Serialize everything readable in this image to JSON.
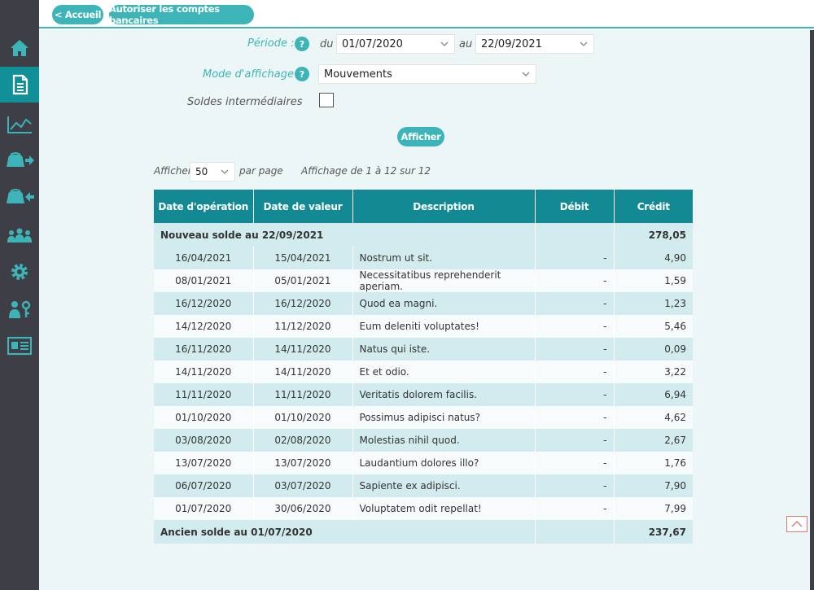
{
  "topbar": {
    "back_label": "< Accueil",
    "authorize_label": "Autoriser les comptes bancaires"
  },
  "sidebar": {
    "items": [
      {
        "icon": "home-icon"
      },
      {
        "icon": "document-icon",
        "active": true
      },
      {
        "icon": "chart-icon"
      },
      {
        "icon": "wallet-out-icon"
      },
      {
        "icon": "wallet-in-icon"
      },
      {
        "icon": "users-icon"
      },
      {
        "icon": "gear-icon"
      },
      {
        "icon": "user-key-icon"
      },
      {
        "icon": "id-card-icon"
      }
    ]
  },
  "filters": {
    "periode_label": "Période :",
    "help_glyph": "?",
    "du_label": "du",
    "date_from": "01/07/2020",
    "au_label": "au",
    "date_to": "22/09/2021",
    "mode_label": "Mode d'affichage :",
    "mode_value": "Mouvements",
    "soldes_label": "Soldes intermédiaires",
    "soldes_checked": false,
    "afficher_button": "Afficher"
  },
  "pagination": {
    "afficher_label": "Afficher",
    "per_page_value": "50",
    "par_page_label": "par page",
    "summary": "Affichage de 1 à 12 sur 12"
  },
  "table": {
    "headers": [
      "Date d'opération",
      "Date de valeur",
      "Description",
      "Débit",
      "Crédit"
    ],
    "nouveau_solde": {
      "label": "Nouveau solde au 22/09/2021",
      "credit": "278,05"
    },
    "rows": [
      {
        "op": "16/04/2021",
        "val": "15/04/2021",
        "desc": "Nostrum ut sit.",
        "debit": "-",
        "credit": "4,90"
      },
      {
        "op": "08/01/2021",
        "val": "05/01/2021",
        "desc": "Necessitatibus reprehenderit aperiam.",
        "debit": "-",
        "credit": "1,59"
      },
      {
        "op": "16/12/2020",
        "val": "16/12/2020",
        "desc": "Quod ea magni.",
        "debit": "-",
        "credit": "1,23"
      },
      {
        "op": "14/12/2020",
        "val": "11/12/2020",
        "desc": "Eum deleniti voluptates!",
        "debit": "-",
        "credit": "5,46"
      },
      {
        "op": "16/11/2020",
        "val": "14/11/2020",
        "desc": "Natus qui iste.",
        "debit": "-",
        "credit": "0,09"
      },
      {
        "op": "14/11/2020",
        "val": "14/11/2020",
        "desc": "Et et odio.",
        "debit": "-",
        "credit": "3,22"
      },
      {
        "op": "11/11/2020",
        "val": "11/11/2020",
        "desc": "Veritatis dolorem facilis.",
        "debit": "-",
        "credit": "6,94"
      },
      {
        "op": "01/10/2020",
        "val": "01/10/2020",
        "desc": "Possimus adipisci natus?",
        "debit": "-",
        "credit": "4,62"
      },
      {
        "op": "03/08/2020",
        "val": "02/08/2020",
        "desc": "Molestias nihil quod.",
        "debit": "-",
        "credit": "2,67"
      },
      {
        "op": "13/07/2020",
        "val": "13/07/2020",
        "desc": "Laudantium dolores illo?",
        "debit": "-",
        "credit": "1,76"
      },
      {
        "op": "06/07/2020",
        "val": "03/07/2020",
        "desc": "Sapiente ex adipisci.",
        "debit": "-",
        "credit": "7,90"
      },
      {
        "op": "01/07/2020",
        "val": "30/06/2020",
        "desc": "Voluptatem odit repellat!",
        "debit": "-",
        "credit": "7,99"
      }
    ],
    "ancien_solde": {
      "label": "Ancien solde au 01/07/2020",
      "credit": "237,67"
    }
  },
  "colors": {
    "accent": "#3db5b8",
    "header": "#138a93",
    "sidebar": "#3e3e47",
    "row_alt": "#d2ebee"
  }
}
